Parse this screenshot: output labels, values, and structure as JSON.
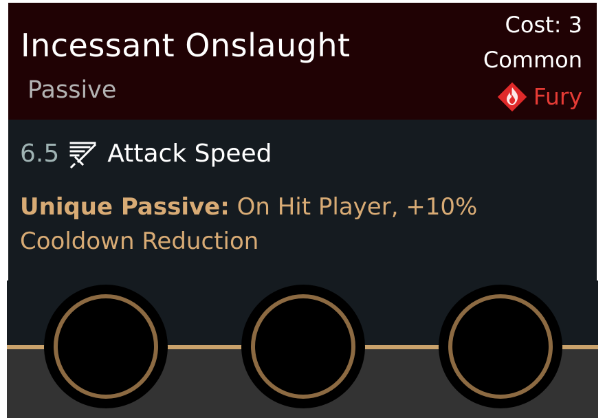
{
  "card": {
    "title": "Incessant Onslaught",
    "subtype": "Passive",
    "cost": "Cost: 3",
    "rarity": "Common",
    "category": {
      "label": "Fury",
      "icon": "fury-flame-icon",
      "color": "#e63b35"
    },
    "stat": {
      "value": "6.5",
      "icon": "attack-speed-icon",
      "name": "Attack Speed"
    },
    "passive": {
      "label": "Unique Passive:",
      "text": " On Hit Player, +10% Cooldown Reduction"
    }
  },
  "slots": [
    {
      "name": "empty-slot"
    },
    {
      "name": "empty-slot"
    },
    {
      "name": "empty-slot"
    }
  ],
  "colors": {
    "header_bg": "#200204",
    "body_bg": "#151b20",
    "accent_gold": "#d8ab75",
    "slot_ring": "#8c6a42"
  }
}
